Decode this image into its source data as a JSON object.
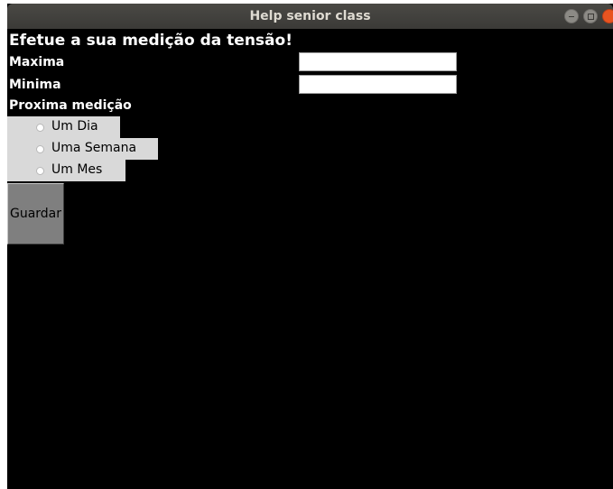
{
  "window": {
    "title": "Help senior class"
  },
  "form": {
    "heading": "Efetue a sua medição da tensão!",
    "max_label": "Maxima",
    "max_value": "",
    "min_label": "Minima",
    "min_value": "",
    "next_label": "Proxima medição",
    "options": [
      {
        "label": "Um Dia",
        "selected": false
      },
      {
        "label": "Uma Semana",
        "selected": false
      },
      {
        "label": "Um Mes",
        "selected": false
      }
    ],
    "save_label": "Guardar"
  },
  "colors": {
    "background": "#000000",
    "radio_bg": "#d9d9d9",
    "button_bg": "#7f7f7f",
    "close_button": "#e95420"
  }
}
